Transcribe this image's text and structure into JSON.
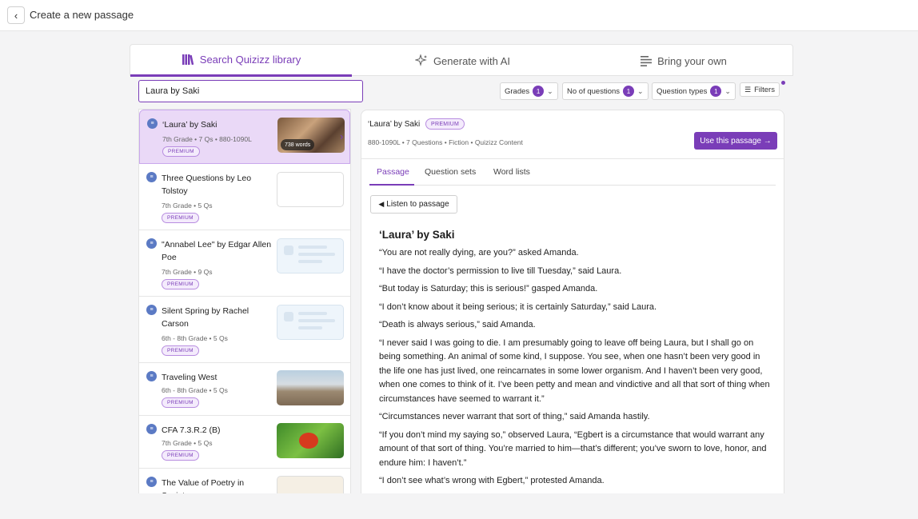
{
  "header": {
    "back_icon": "‹",
    "title": "Create a new passage"
  },
  "tabs": [
    {
      "label": "Search Quizizz library",
      "icon": "library-icon",
      "active": true
    },
    {
      "label": "Generate with AI",
      "icon": "sparkle-icon",
      "active": false
    },
    {
      "label": "Bring your own",
      "icon": "text-lines-icon",
      "active": false
    }
  ],
  "search": {
    "value": "Laura by Saki"
  },
  "filters": {
    "grades": {
      "label": "Grades",
      "count": "1"
    },
    "questions": {
      "label": "No of questions",
      "count": "1"
    },
    "types": {
      "label": "Question types",
      "count": "1"
    },
    "more": {
      "label": "Filters"
    }
  },
  "results": [
    {
      "title": "‘Laura’ by Saki",
      "meta": "7th Grade • 7 Qs • 880-1090L",
      "badge": "PREMIUM",
      "thumb_label": "738 words"
    },
    {
      "title": "Three Questions by Leo Tolstoy",
      "meta": "7th Grade • 5 Qs",
      "badge": "PREMIUM"
    },
    {
      "title": "\"Annabel Lee\" by Edgar Allen Poe",
      "meta": "7th Grade • 9 Qs",
      "badge": "PREMIUM"
    },
    {
      "title": "Silent Spring by Rachel Carson",
      "meta": "6th - 8th Grade • 5 Qs",
      "badge": "PREMIUM"
    },
    {
      "title": "Traveling West",
      "meta": "6th - 8th Grade • 5 Qs",
      "badge": "PREMIUM"
    },
    {
      "title": "CFA 7.3.R.2 (B)",
      "meta": "7th Grade • 5 Qs",
      "badge": "PREMIUM"
    },
    {
      "title": "The Value of Poetry in Society",
      "meta": "",
      "badge": ""
    }
  ],
  "detail": {
    "title": "‘Laura’ by Saki",
    "badge": "PREMIUM",
    "meta": "880-1090L • 7 Questions • Fiction • Quizizz Content",
    "use_button": "Use this passage →",
    "tabs": [
      "Passage",
      "Question sets",
      "Word lists"
    ],
    "listen": "Listen to passage",
    "passage_title": "‘Laura’ by Saki",
    "paragraphs": [
      "“You are not really dying, are you?” asked Amanda.",
      "“I have the doctor’s permission to live till Tuesday,” said Laura.",
      "“But today is Saturday; this is serious!” gasped Amanda.",
      "“I don’t know about it being serious; it is certainly Saturday,” said Laura.",
      "“Death is always serious,” said Amanda.",
      "“I never said I was going to die. I am presumably going to leave off being Laura, but I shall go on being something. An animal of some kind, I suppose. You see, when one hasn’t been very good in the life one has just lived, one reincarnates in some lower organism. And I haven’t been very good, when one comes to think of it. I’ve been petty and mean and vindictive and all that sort of thing when circumstances have seemed to warrant it.”",
      "“Circumstances never warrant that sort of thing,” said Amanda hastily.",
      "“If you don’t mind my saying so,” observed Laura, “Egbert is a circumstance that would warrant any amount of that sort of thing. You’re married to him—that’s different; you’ve sworn to love, honor, and endure him: I haven’t.”",
      "“I don’t see what’s wrong with Egbert,” protested Amanda."
    ]
  }
}
